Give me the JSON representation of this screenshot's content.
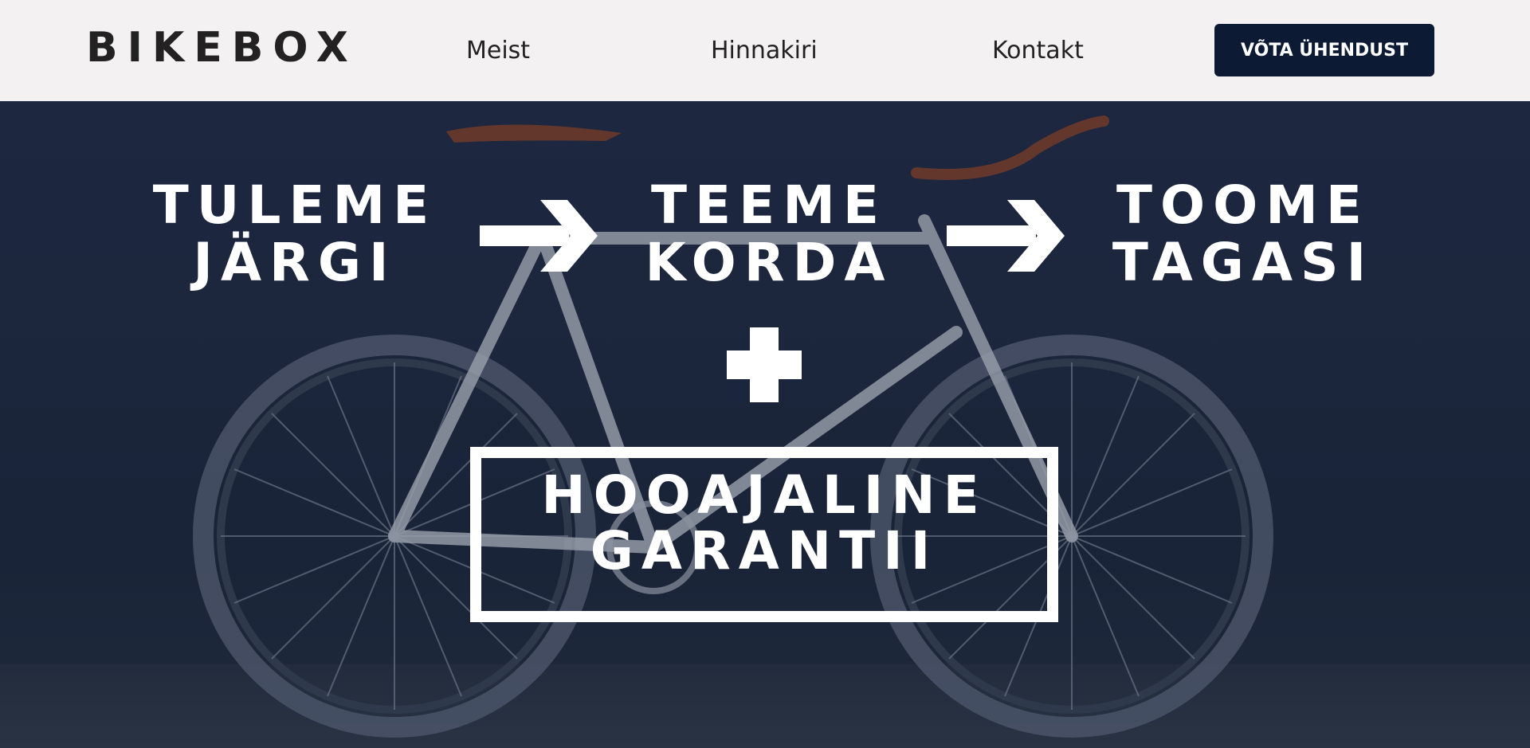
{
  "header": {
    "logo": "BIKEBOX",
    "nav": {
      "meist": "Meist",
      "hinnakiri": "Hinnakiri",
      "kontakt": "Kontakt"
    },
    "cta_label": "VÕTA ÜHENDUST"
  },
  "hero": {
    "steps": [
      {
        "line1": "TULEME",
        "line2": "JÄRGI"
      },
      {
        "line1": "TEEME",
        "line2": "KORDA"
      },
      {
        "line1": "TOOME",
        "line2": "TAGASI"
      }
    ],
    "guarantee": {
      "line1": "HOOAJALINE",
      "line2": "GARANTII"
    },
    "icons": [
      "arrow-right-icon",
      "arrow-right-icon",
      "plus-icon"
    ]
  },
  "colors": {
    "header_bg": "#f3f1f2",
    "cta_bg": "#0d1a33",
    "hero_bg": "#1b2538",
    "text_light": "#ffffff"
  }
}
